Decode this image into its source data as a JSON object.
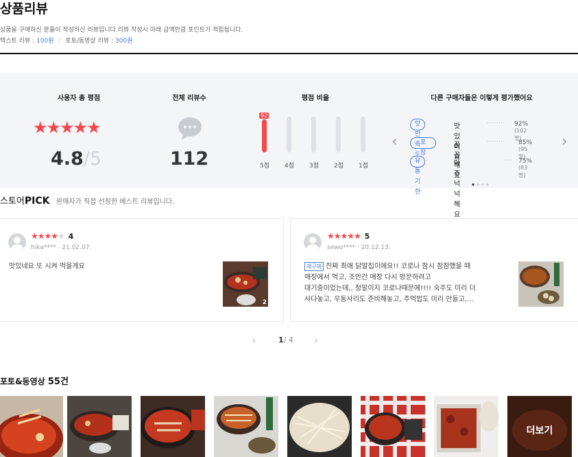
{
  "header": {
    "title": "상품리뷰",
    "desc": "상품을 구매하신 분들이 작성하신 리뷰입니다.리뷰 작성시 아래 금액만큼 포인트가 적립됩니다.",
    "text_review_label": "텍스트 리뷰 :",
    "text_review_point": "100원",
    "photo_review_label": "포토/동영상 리뷰 :",
    "photo_review_point": "300원",
    "separator": "|"
  },
  "summary": {
    "total_rating_title": "사용자 총 평점",
    "stars": "★★★★★",
    "score": "4.8",
    "score_max": "/5",
    "total_reviews_title": "전체 리뷰수",
    "total_reviews": "112",
    "ratio_title": "평점 비율",
    "ratio": [
      {
        "label": "5점",
        "percent": 92
      },
      {
        "label": "4점",
        "percent": 0
      },
      {
        "label": "3점",
        "percent": 0
      },
      {
        "label": "2점",
        "percent": 0
      },
      {
        "label": "1점",
        "percent": 0
      }
    ],
    "top_badge": "92",
    "others_title": "다른 구매자들은 이렇게 평가했어요",
    "evaluations": [
      {
        "tag": "맛 만족도",
        "text": "맛있어요",
        "dots": "·········",
        "pct": "92%",
        "count": "(102명)"
      },
      {
        "tag": "포장",
        "text": "꼼꼼해요",
        "dots": "·········",
        "pct": "85%",
        "count": "(95명)"
      },
      {
        "tag": "유통기한",
        "text": "아주 넉넉해요",
        "dots": "····",
        "pct": "75%",
        "count": "(83명)"
      }
    ],
    "prev_icon": "‹",
    "next_icon": "›"
  },
  "pick": {
    "title_prefix": "스토어",
    "title_bold": "PICK",
    "desc": "판매자가 직접 선정한 베스트 리뷰입니다.",
    "reviews": [
      {
        "stars_on": "★★★★",
        "stars_off": "★",
        "score": "4",
        "user": "hika****",
        "date": "21.02.07.",
        "text": "맛있네요 또 시켜 먹을게요",
        "photo_count": "2"
      },
      {
        "stars_on": "★★★★★",
        "stars_off": "",
        "score": "5",
        "user": "sewo****",
        "date": "20.12.13.",
        "badge": "재구매",
        "line1": "진짜 최애 닭발집이에요!! 코로나 잠시 잠잠했을 때",
        "line2": "매장에서 먹고, 조만간 매장 다시 방문하려고",
        "line3": "대기중이었는데,, 정말이지 코로나때문에!!!! 숙주도 미리 더",
        "line4": "사다놓고, 우동사리도 준비해놓고, 주먹밥도 미리 만들고,..."
      }
    ],
    "pager_current": "1",
    "pager_total": "/ 4",
    "prev_icon": "‹",
    "next_icon": "›"
  },
  "photos": {
    "title_prefix": "포토&동영상",
    "count": "55건",
    "more": "더보기"
  }
}
